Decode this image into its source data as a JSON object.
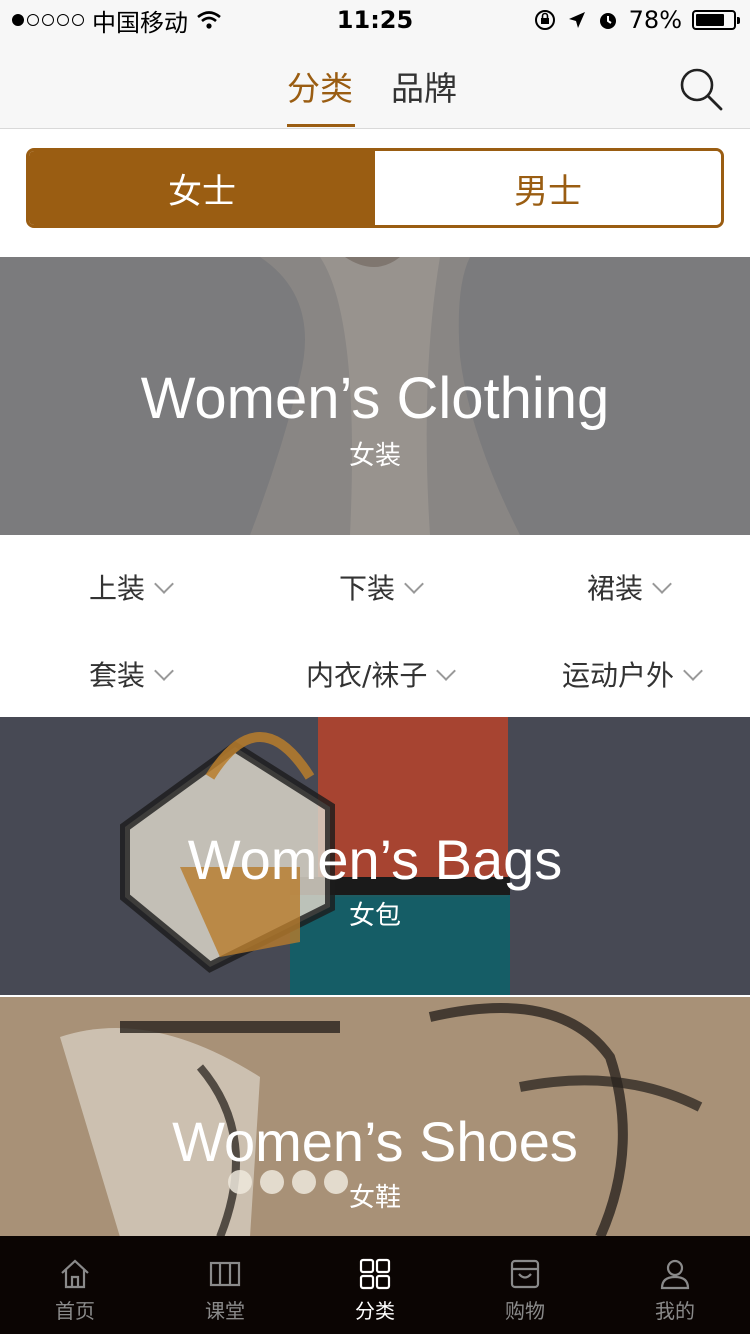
{
  "status_bar": {
    "carrier": "中国移动",
    "time": "11:25",
    "battery_percent": "78%",
    "battery_level": 0.78
  },
  "top_nav": {
    "tabs": [
      "分类",
      "品牌"
    ],
    "active_tab": "分类",
    "search_icon": "search-icon"
  },
  "segment": {
    "options": [
      "女士",
      "男士"
    ],
    "selected": "女士"
  },
  "banners": [
    {
      "title": "Women’s Clothing",
      "subtitle": "女装"
    },
    {
      "title": "Women’s Bags",
      "subtitle": "女包"
    },
    {
      "title": "Women’s Shoes",
      "subtitle": "女鞋"
    }
  ],
  "subcategories": [
    "上装",
    "下装",
    "裙装",
    "套装",
    "内衣/袜子",
    "运动户外"
  ],
  "tab_bar": {
    "items": [
      {
        "label": "首页",
        "icon": "home-icon"
      },
      {
        "label": "课堂",
        "icon": "book-icon"
      },
      {
        "label": "分类",
        "icon": "grid-icon"
      },
      {
        "label": "购物",
        "icon": "bag-icon"
      },
      {
        "label": "我的",
        "icon": "user-icon"
      }
    ],
    "active": "分类"
  },
  "colors": {
    "accent": "#9a5d12",
    "tab_bar_bg": "#0b0503"
  }
}
